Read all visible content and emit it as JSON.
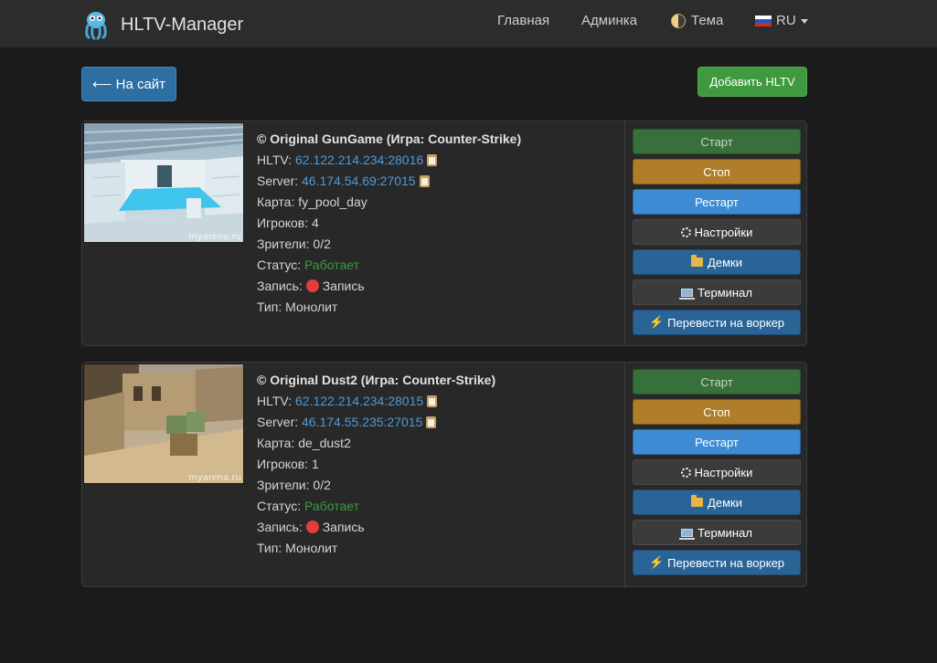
{
  "nav": {
    "brand": "HLTV-Manager",
    "home": "Главная",
    "admin": "Админка",
    "theme": "Тема",
    "lang": "RU"
  },
  "toolbar": {
    "back_label": "⟵ На сайт",
    "add_label": "Добавить HLTV"
  },
  "labels": {
    "hltv": "HLTV: ",
    "server": "Server: ",
    "map": "Карта: ",
    "players": "Игроков: ",
    "spectators": "Зрители: ",
    "status": "Статус: ",
    "record": "Запись: ",
    "type": "Тип: "
  },
  "actions": {
    "start": "Старт",
    "stop": "Стоп",
    "restart": "Рестарт",
    "settings": "Настройки",
    "demos": "Демки",
    "terminal": "Терминал",
    "worker": "Перевести на воркер"
  },
  "servers": [
    {
      "title": "© Original GunGame (Игра: Counter-Strike)",
      "hltv": "62.122.214.234:28016",
      "server": "46.174.54.69:27015",
      "map": "fy_pool_day",
      "players": "4",
      "spectators": "0/2",
      "status": "Работает",
      "record": "Запись",
      "type": "Монолит",
      "watermark": "myarena.ru"
    },
    {
      "title": "© Original Dust2 (Игра: Counter-Strike)",
      "hltv": "62.122.214.234:28015",
      "server": "46.174.55.235:27015",
      "map": "de_dust2",
      "players": "1",
      "spectators": "0/2",
      "status": "Работает",
      "record": "Запись",
      "type": "Монолит",
      "watermark": "myarena.ru"
    }
  ],
  "colors": {
    "accent_blue": "#3d8bd3",
    "success_green": "#3c9a3c",
    "warning_orange": "#b07d2b",
    "background": "#1b1b1b"
  }
}
